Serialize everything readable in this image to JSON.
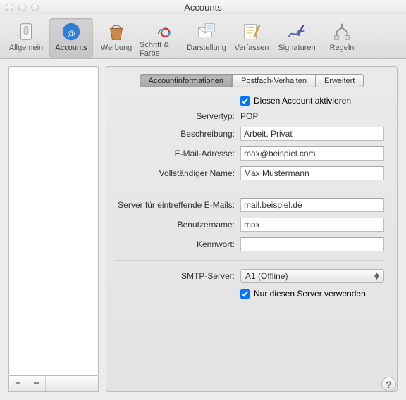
{
  "window": {
    "title": "Accounts"
  },
  "toolbar": [
    {
      "id": "general",
      "label": "Allgemein"
    },
    {
      "id": "accounts",
      "label": "Accounts",
      "active": true
    },
    {
      "id": "ads",
      "label": "Werbung"
    },
    {
      "id": "fonts",
      "label": "Schrift & Farbe"
    },
    {
      "id": "display",
      "label": "Darstellung"
    },
    {
      "id": "compose",
      "label": "Verfassen"
    },
    {
      "id": "sigs",
      "label": "Signaturen"
    },
    {
      "id": "rules",
      "label": "Regeln"
    }
  ],
  "tabs": {
    "info": "Accountinformationen",
    "mailbox": "Postfach-Verhalten",
    "advanced": "Erweitert"
  },
  "form": {
    "activate_label": "Diesen Account aktivieren",
    "servertype_label": "Servertyp:",
    "servertype_value": "POP",
    "desc_label": "Beschreibung:",
    "desc_value": "Arbeit, Privat",
    "email_label": "E-Mail-Adresse:",
    "email_value": "max@beispiel.com",
    "fullname_label": "Vollständiger Name:",
    "fullname_value": "Max Mustermann",
    "incoming_label": "Server für eintreffende E-Mails:",
    "incoming_value": "mail.beispiel.de",
    "user_label": "Benutzername:",
    "user_value": "max",
    "pass_label": "Kennwort:",
    "pass_value": "",
    "smtp_label": "SMTP-Server:",
    "smtp_value": "A1 (Offline)",
    "only_label": "Nur diesen Server verwenden"
  },
  "buttons": {
    "plus": "+",
    "minus": "−",
    "help": "?"
  }
}
